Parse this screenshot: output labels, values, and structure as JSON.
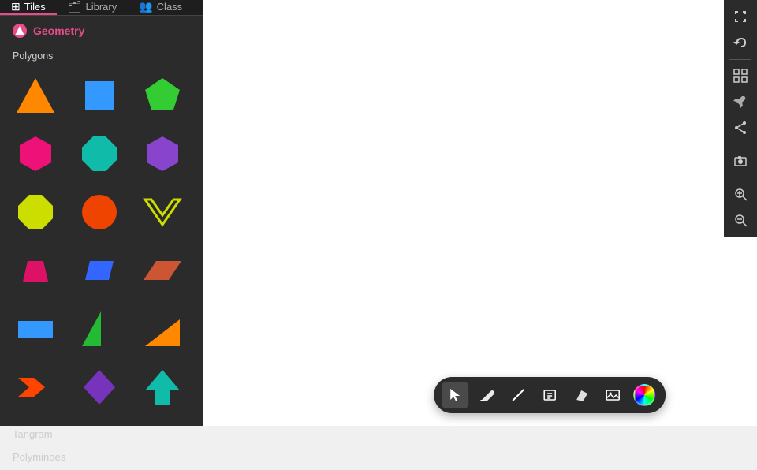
{
  "tabs": [
    {
      "id": "tiles",
      "label": "Tiles",
      "icon": "⊞",
      "active": true
    },
    {
      "id": "library",
      "label": "Library",
      "icon": "📚",
      "active": false
    },
    {
      "id": "class",
      "label": "Class",
      "icon": "👥",
      "active": false
    }
  ],
  "section": {
    "name": "Geometry",
    "icon": "G"
  },
  "categories": [
    {
      "id": "polygons",
      "label": "Polygons"
    },
    {
      "id": "tangram",
      "label": "Tangram"
    },
    {
      "id": "polyminoes",
      "label": "Polyminoes"
    }
  ],
  "right_toolbar": {
    "buttons": [
      {
        "id": "fullscreen",
        "icon": "⛶",
        "label": "Fullscreen"
      },
      {
        "id": "undo",
        "icon": "↩",
        "label": "Undo"
      },
      {
        "id": "grid",
        "icon": "⊞",
        "label": "Grid"
      },
      {
        "id": "tools",
        "icon": "🔧",
        "label": "Tools"
      },
      {
        "id": "share",
        "icon": "⬆",
        "label": "Share"
      },
      {
        "id": "screenshot",
        "icon": "📷",
        "label": "Screenshot"
      },
      {
        "id": "zoom-in",
        "icon": "🔍+",
        "label": "Zoom In"
      },
      {
        "id": "zoom-out",
        "icon": "🔍-",
        "label": "Zoom Out"
      }
    ]
  },
  "bottom_toolbar": {
    "buttons": [
      {
        "id": "select",
        "label": "Select",
        "icon": "cursor",
        "active": true
      },
      {
        "id": "pen",
        "label": "Pen",
        "icon": "pen"
      },
      {
        "id": "line",
        "label": "Line",
        "icon": "line"
      },
      {
        "id": "text",
        "label": "Text",
        "icon": "text"
      },
      {
        "id": "eraser",
        "label": "Eraser",
        "icon": "eraser"
      },
      {
        "id": "image",
        "label": "Image",
        "icon": "image"
      }
    ],
    "color_picker_label": "Color Picker"
  }
}
